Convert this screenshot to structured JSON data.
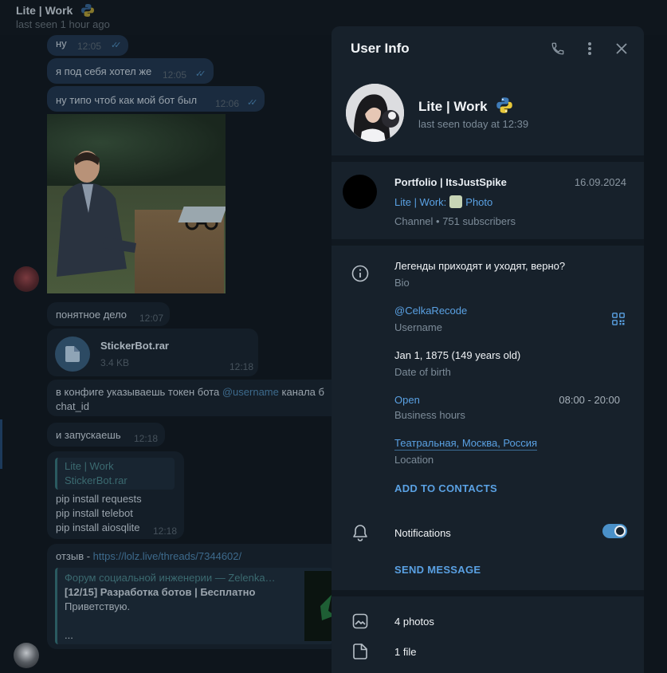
{
  "chat": {
    "header_title": "Lite | Work",
    "header_status": "last seen 1 hour ago",
    "messages": [
      {
        "text": "ну",
        "time": "12:05"
      },
      {
        "text": "я под себя хотел же",
        "time": "12:05"
      },
      {
        "text": "ну типо чтоб как мой бот был",
        "time": "12:06"
      },
      {
        "text": "понятное дело",
        "time": "12:07"
      },
      {
        "file_name": "StickerBot.rar",
        "file_size": "3.4 KB",
        "time": "12:18"
      },
      {
        "line1_a": "в конфиге указываешь токен бота ",
        "line1_link": "@username",
        "line1_b": " канала б",
        "line2": "chat_id"
      },
      {
        "text": "и запускаешь",
        "time": "12:18"
      },
      {
        "reply_title": "Lite | Work",
        "reply_text": "StickerBot.rar",
        "lines": [
          "pip install requests",
          "pip install telebot",
          "pip install aiosqlite"
        ],
        "time": "12:18"
      },
      {
        "prefix": "отзыв - ",
        "link": "https://lolz.live/threads/7344602/",
        "preview_site": "Форум социальной инженерии — Zelenka…",
        "preview_title": "[12/15] Разработка ботов | Бесплатно",
        "preview_text": "Приветствую.",
        "preview_more": "..."
      }
    ]
  },
  "panel": {
    "title": "User Info",
    "name": "Lite | Work",
    "status": "last seen today at 12:39",
    "channel": {
      "name": "Portfolio | ItsJustSpike",
      "date": "16.09.2024",
      "preview_author": "Lite | Work:",
      "preview_type": "Photo",
      "meta": "Channel • 751 subscribers"
    },
    "bio": {
      "value": "Легенды приходят и уходят, верно?",
      "label": "Bio"
    },
    "username": {
      "value": "@CelkaRecode",
      "label": "Username"
    },
    "birth": {
      "value": "Jan 1, 1875 (149 years old)",
      "label": "Date of birth"
    },
    "hours": {
      "value": "Open",
      "label": "Business hours",
      "range": "08:00 - 20:00"
    },
    "location": {
      "value": "Театральная, Москва, Россия",
      "label": "Location"
    },
    "add_contacts": "ADD TO CONTACTS",
    "notifications": {
      "label": "Notifications",
      "enabled": true
    },
    "send_message": "SEND MESSAGE",
    "media": {
      "photos": "4 photos",
      "files": "1 file"
    }
  },
  "colors": {
    "accent": "#5aa1e3",
    "panel_bg": "#17212b",
    "separator": "#101820"
  }
}
